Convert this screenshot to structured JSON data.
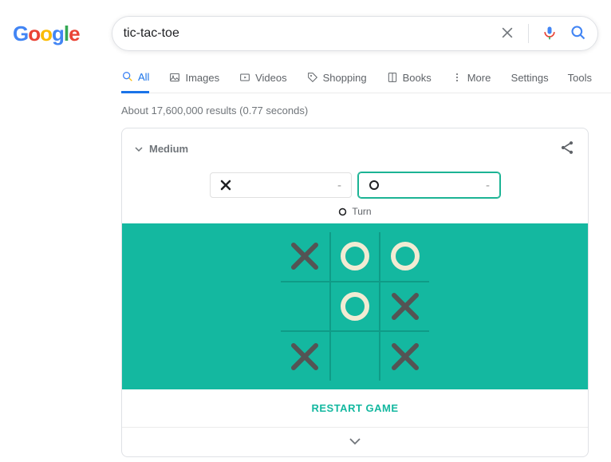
{
  "search": {
    "query": "tic-tac-toe"
  },
  "tabs": {
    "all": "All",
    "images": "Images",
    "videos": "Videos",
    "shopping": "Shopping",
    "books": "Books",
    "more": "More",
    "settings": "Settings",
    "tools": "Tools"
  },
  "results_info": "About 17,600,000 results (0.77 seconds)",
  "game": {
    "difficulty": "Medium",
    "player_x_score": "-",
    "player_o_score": "-",
    "turn_label": "Turn",
    "current_turn": "O",
    "board": [
      [
        "X",
        "O",
        "O"
      ],
      [
        "",
        "O",
        "X"
      ],
      [
        "X",
        "",
        "X"
      ]
    ],
    "restart_label": "RESTART GAME"
  },
  "colors": {
    "board_bg": "#14b8a0",
    "grid_line": "#0f9b87",
    "x_color": "#545454",
    "o_color": "#f2ebd3",
    "accent": "#1a73e8"
  }
}
